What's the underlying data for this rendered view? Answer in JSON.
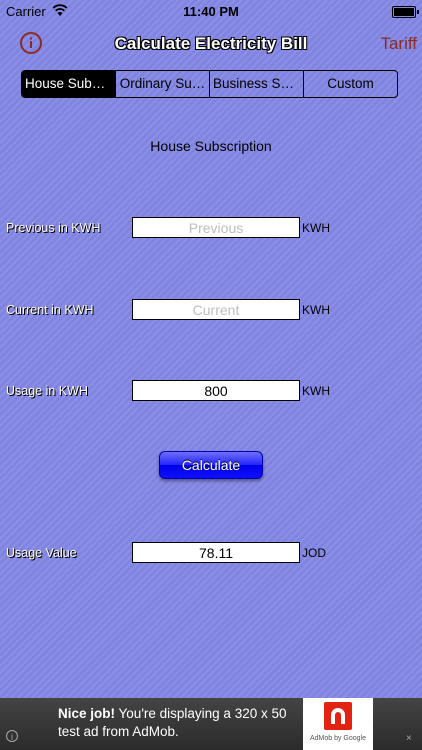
{
  "status_bar": {
    "carrier": "Carrier",
    "time": "11:40 PM"
  },
  "nav": {
    "title": "Calculate Electricity Bill",
    "tariff_label": "Tariff"
  },
  "segments": [
    {
      "label": "House Subs…",
      "selected": true
    },
    {
      "label": "Ordinary Su…",
      "selected": false
    },
    {
      "label": "Business Su…",
      "selected": false
    },
    {
      "label": "Custom",
      "selected": false
    }
  ],
  "section_title": "House Subscription",
  "fields": {
    "previous": {
      "label": "Previous in KWH",
      "placeholder": "Previous",
      "value": "",
      "unit": "KWH"
    },
    "current": {
      "label": "Current in KWH",
      "placeholder": "Current",
      "value": "",
      "unit": "KWH"
    },
    "usage": {
      "label": "Usage in KWH",
      "value": "800",
      "unit": "KWH"
    },
    "usage_value": {
      "label": "Usage Value",
      "value": "78.11",
      "unit": "JOD"
    }
  },
  "calculate_label": "Calculate",
  "ad": {
    "headline": "Nice job!",
    "body": "You're displaying a 320 x 50 test ad from AdMob.",
    "logo_caption": "AdMob by Google",
    "info_glyph": "i",
    "close_glyph": "×"
  },
  "colors": {
    "background": "#8588e6",
    "accent": "#8a2c25",
    "button": "#1a1aff",
    "ad_logo": "#e32212"
  }
}
